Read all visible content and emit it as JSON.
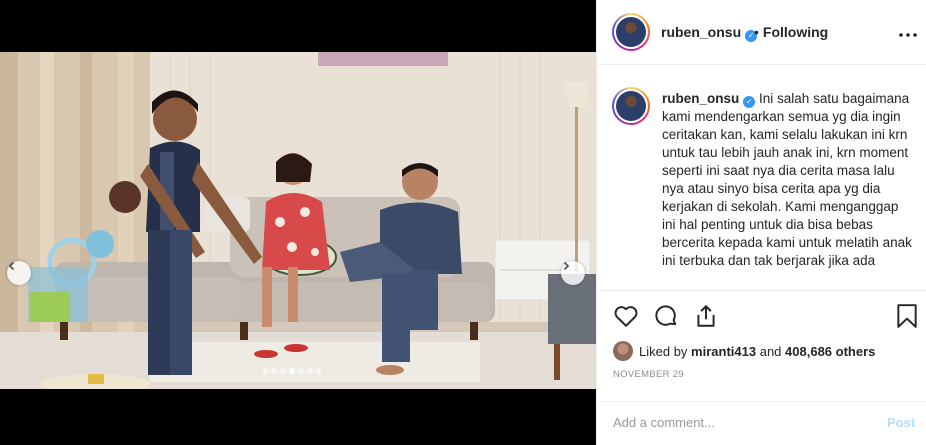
{
  "post": {
    "username": "ruben_onsu",
    "verified_mark": "✓",
    "follow_status": "Following",
    "separator": "•",
    "more_icon": "more-dots-icon",
    "caption_text": "Ini salah satu bagaimana kami mendengarkan semua yg dia ingin ceritakan kan, kami selalu lakukan ini krn untuk tau lebih jauh anak ini, krn moment seperti ini saat nya dia cerita masa lalu nya atau sinyo bisa cerita apa yg dia kerjakan di sekolah. Kami menganggap ini hal penting untuk dia bisa bebas bercerita kepada kami untuk melatih anak ini terbuka dan tak berjarak jika ada",
    "liked_by_prefix": "Liked by",
    "liked_by_user": "miranti413",
    "liked_by_and": "and",
    "likes_others": "408,686 others",
    "date": "NOVEMBER 29",
    "comment_placeholder": "Add a comment...",
    "post_label": "Post"
  },
  "carousel": {
    "total_slides": 7,
    "active_slide": 4
  },
  "colors": {
    "verified": "#3897f0",
    "post_disabled": "#b2dffc",
    "meta_gray": "#8e8e8e"
  }
}
